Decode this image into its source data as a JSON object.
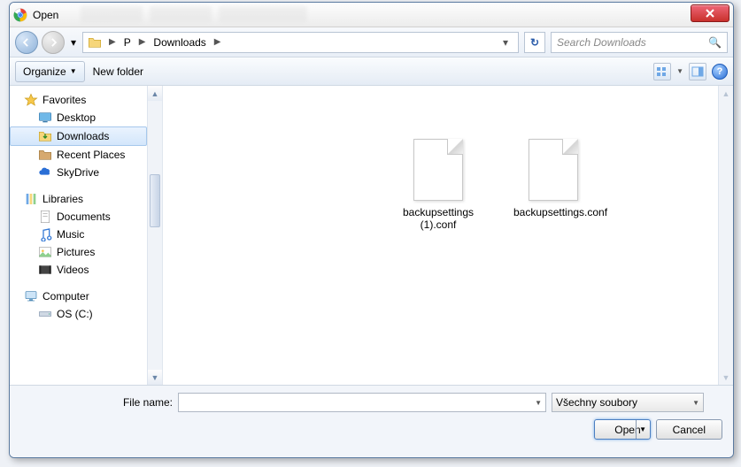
{
  "title": "Open",
  "breadcrumb": {
    "root": "P",
    "folder": "Downloads"
  },
  "search_placeholder": "Search Downloads",
  "toolbar": {
    "organize": "Organize",
    "new_folder": "New folder"
  },
  "sidebar": {
    "favorites": {
      "label": "Favorites",
      "items": [
        {
          "label": "Desktop"
        },
        {
          "label": "Downloads"
        },
        {
          "label": "Recent Places"
        },
        {
          "label": "SkyDrive"
        }
      ]
    },
    "libraries": {
      "label": "Libraries",
      "items": [
        {
          "label": "Documents"
        },
        {
          "label": "Music"
        },
        {
          "label": "Pictures"
        },
        {
          "label": "Videos"
        }
      ]
    },
    "computer": {
      "label": "Computer",
      "items": [
        {
          "label": "OS (C:)"
        }
      ]
    }
  },
  "files": [
    {
      "name": "backupsettings (1).conf"
    },
    {
      "name": "backupsettings.conf"
    }
  ],
  "bottom": {
    "filename_label": "File name:",
    "filename_value": "",
    "filetype": "Všechny soubory",
    "open": "Open",
    "cancel": "Cancel"
  }
}
